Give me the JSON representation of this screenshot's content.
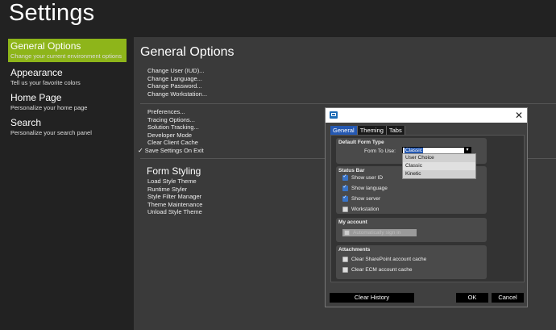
{
  "app_title": "Settings",
  "sidebar": {
    "items": [
      {
        "title": "General Options",
        "subtitle": "Change your current environment options",
        "active": true
      },
      {
        "title": "Appearance",
        "subtitle": "Tell us your favorite colors"
      },
      {
        "title": "Home Page",
        "subtitle": "Personalize your home page"
      },
      {
        "title": "Search",
        "subtitle": "Personalize your search panel"
      }
    ]
  },
  "main": {
    "heading": "General Options",
    "user_links": [
      "Change User (IUD)...",
      "Change Language...",
      "Change Password...",
      "Change Workstation..."
    ],
    "tool_links": [
      "Preferences...",
      "Tracing Options...",
      "Solution Tracking...",
      "Developer Mode",
      "Clear Client Cache"
    ],
    "save_settings": "Save Settings On Exit",
    "form_styling": {
      "title": "Form Styling",
      "items": [
        "Load Style Theme",
        "Runtime Styler",
        "Style Filter Manager",
        "Theme Maintenance",
        "Unload Style Theme"
      ]
    }
  },
  "dialog": {
    "tabs": [
      "General",
      "Theming",
      "Tabs"
    ],
    "default_form": {
      "title": "Default Form Type",
      "label": "Form To Use:",
      "selected": "Classic",
      "options": [
        "User Choice",
        "Classic",
        "Kinetic"
      ]
    },
    "status_bar": {
      "title": "Status Bar",
      "items": [
        {
          "label": "Show user ID",
          "checked": true
        },
        {
          "label": "Show language",
          "checked": true
        },
        {
          "label": "Show server",
          "checked": true
        },
        {
          "label": "Workstation",
          "checked": false
        }
      ]
    },
    "my_account": {
      "title": "My account",
      "item": "Automatically sign in"
    },
    "attachments": {
      "title": "Attachments",
      "items": [
        "Clear SharePoint account cache",
        "Clear ECM account cache"
      ]
    },
    "buttons": {
      "clear_history": "Clear History",
      "ok": "OK",
      "cancel": "Cancel"
    }
  }
}
